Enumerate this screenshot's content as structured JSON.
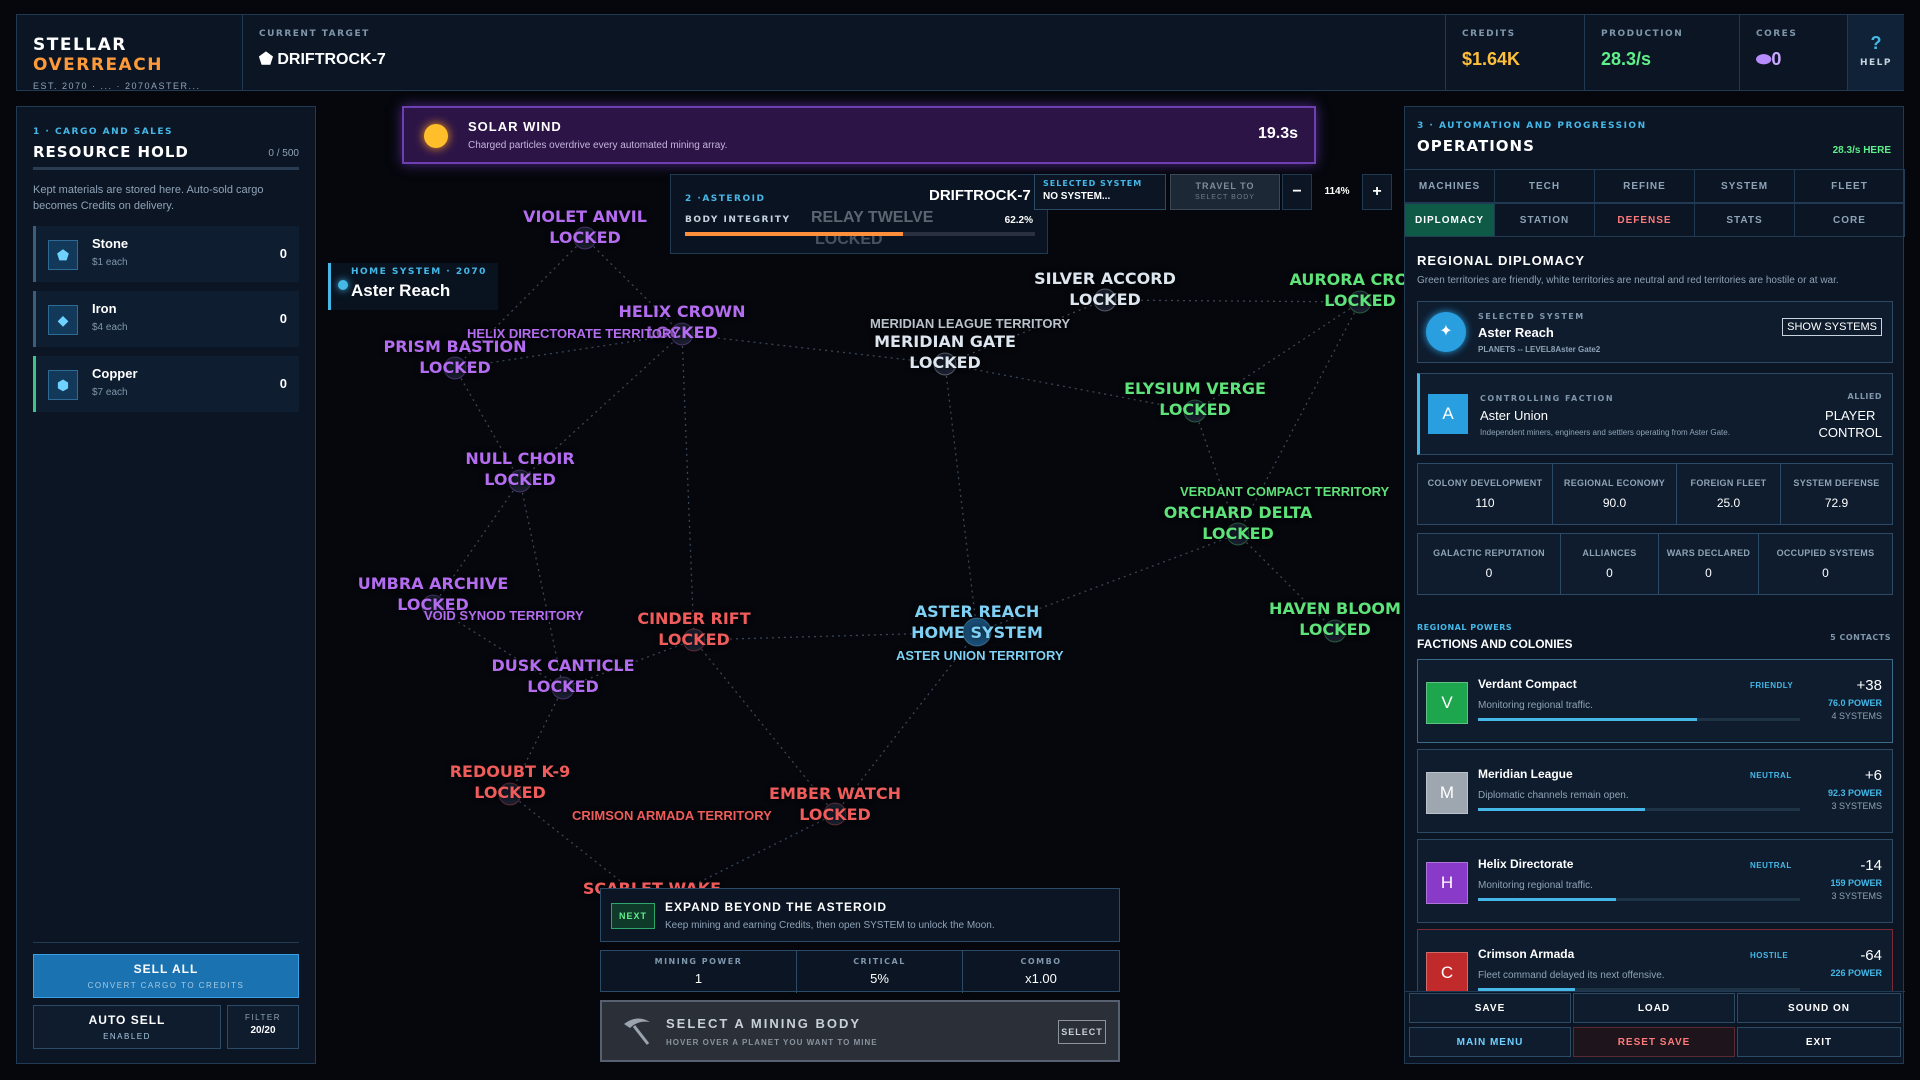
{
  "topbar": {
    "brand_1": "STELLAR ",
    "brand_2": "OVERREACH",
    "brand_sub": "EST. 2070 · ... · 2070ASTER...",
    "target_label": "CURRENT TARGET",
    "target_value": "DRIFTROCK-7",
    "credits_label": "CREDITS",
    "credits_value": "$1.64K",
    "production_label": "PRODUCTION",
    "production_value": "28.3/s",
    "cores_label": "CORES",
    "cores_value": "0",
    "help_icon": "?",
    "help_label": "HELP"
  },
  "left": {
    "section_label": "1 · CARGO AND SALES",
    "title": "RESOURCE HOLD",
    "capacity": "0 / 500",
    "desc": "Kept materials are stored here. Auto-sold cargo becomes Credits on delivery.",
    "resources": [
      {
        "name": "Stone",
        "price": "$1 each",
        "qty": "0",
        "icon": "pentagon-icon",
        "glyph": "⬟",
        "accent": "#3a5e80"
      },
      {
        "name": "Iron",
        "price": "$4 each",
        "qty": "0",
        "icon": "diamond-icon",
        "glyph": "◆",
        "accent": "#3a5e80"
      },
      {
        "name": "Copper",
        "price": "$7 each",
        "qty": "0",
        "icon": "hexagon-icon",
        "glyph": "⬢",
        "accent": "#3fc487"
      }
    ],
    "sell_all": "SELL ALL",
    "sell_all_sub": "CONVERT CARGO TO CREDITS",
    "auto_sell": "AUTO SELL",
    "auto_sell_sub": "ENABLED",
    "filter_label": "FILTER",
    "filter_value": "20/20"
  },
  "event": {
    "title": "SOLAR WIND",
    "desc": "Charged particles overdrive every automated mining array.",
    "timer": "19.3s"
  },
  "asteroid": {
    "label": "2 ·ASTEROID",
    "name": "DRIFTROCK-7",
    "integrity_label": "BODY INTEGRITY",
    "integrity_value": "62.2%",
    "integrity": 0.622,
    "ghost_1": "RELAY TWELVE",
    "ghost_2": "LOCKED"
  },
  "map_controls": {
    "selected_label": "SELECTED SYSTEM",
    "selected_value": "NO SYSTEM...",
    "travel_1": "TRAVEL TO",
    "travel_2": "SELECT BODY",
    "zoom_out": "−",
    "zoom": "114%",
    "zoom_in": "+"
  },
  "home": {
    "label": "HOME SYSTEM · 2070",
    "name": "Aster Reach"
  },
  "map": {
    "nodes": [
      {
        "id": "violet-anvil",
        "name": "VIOLET ANVIL",
        "status": "LOCKED",
        "cls": "c-purple"
      },
      {
        "id": "helix-crown",
        "name": "HELIX CROWN",
        "status": "LOCKED",
        "cls": "c-purple"
      },
      {
        "id": "prism-bastion",
        "name": "PRISM BASTION",
        "status": "LOCKED",
        "cls": "c-purple"
      },
      {
        "id": "meridian-gate",
        "name": "MERIDIAN GATE",
        "status": "LOCKED",
        "cls": "c-white"
      },
      {
        "id": "silver-accord",
        "name": "SILVER ACCORD",
        "status": "LOCKED",
        "cls": "c-white"
      },
      {
        "id": "aurora-cross",
        "name": "AURORA CROSS",
        "status": "LOCKED",
        "cls": "c-green"
      },
      {
        "id": "elysium-verge",
        "name": "ELYSIUM VERGE",
        "status": "LOCKED",
        "cls": "c-green"
      },
      {
        "id": "null-choir",
        "name": "NULL CHOIR",
        "status": "LOCKED",
        "cls": "c-purple"
      },
      {
        "id": "orchard-delta",
        "name": "ORCHARD DELTA",
        "status": "LOCKED",
        "cls": "c-green"
      },
      {
        "id": "umbra-archive",
        "name": "UMBRA ARCHIVE",
        "status": "LOCKED",
        "cls": "c-purple"
      },
      {
        "id": "cinder-rift",
        "name": "CINDER RIFT",
        "status": "LOCKED",
        "cls": "c-red"
      },
      {
        "id": "aster-reach",
        "name": "ASTER REACH",
        "status": "HOME SYSTEM",
        "cls": "c-blue"
      },
      {
        "id": "haven-bloom",
        "name": "HAVEN BLOOM",
        "status": "LOCKED",
        "cls": "c-green"
      },
      {
        "id": "dusk-canticle",
        "name": "DUSK CANTICLE",
        "status": "LOCKED",
        "cls": "c-purple"
      },
      {
        "id": "redoubt-k9",
        "name": "REDOUBT K-9",
        "status": "LOCKED",
        "cls": "c-red"
      },
      {
        "id": "ember-watch",
        "name": "EMBER WATCH",
        "status": "LOCKED",
        "cls": "c-red"
      },
      {
        "id": "scarlet-wake",
        "name": "SCARLET WAKE",
        "status": "",
        "cls": "c-red"
      }
    ],
    "territories": {
      "helix": "HELIX DIRECTORATE TERRITORY",
      "meridian": "MERIDIAN LEAGUE TERRITORY",
      "verdant": "VERDANT COMPACT TERRITORY",
      "void": "VOID SYNOD TERRITORY",
      "aster": "ASTER UNION TERRITORY",
      "crimson": "CRIMSON ARMADA TERRITORY"
    }
  },
  "objective": {
    "badge": "NEXT",
    "title": "EXPAND BEYOND THE ASTEROID",
    "desc": "Keep mining and earning Credits, then open SYSTEM to unlock the Moon."
  },
  "mining": {
    "power_label": "MINING POWER",
    "power_value": "1",
    "critical_label": "CRITICAL",
    "critical_value": "5%",
    "combo_label": "COMBO",
    "combo_value": "x1.00",
    "action_title": "SELECT A MINING BODY",
    "action_sub": "HOVER OVER A PLANET YOU WANT TO MINE",
    "select_btn": "SELECT"
  },
  "right": {
    "section_label": "3 · AUTOMATION AND PROGRESSION",
    "title": "OPERATIONS",
    "rate": "28.3/s HERE",
    "tabs_row1": [
      "MACHINES",
      "TECH",
      "REFINE",
      "SYSTEM",
      "FLEET"
    ],
    "tabs_row2": [
      "DIPLOMACY",
      "STATION",
      "DEFENSE",
      "STATS",
      "CORE"
    ],
    "diplo_title": "REGIONAL DIPLOMACY",
    "diplo_desc": "Green territories are friendly, white territories are neutral and red territories are hostile or at war.",
    "sel_label": "SELECTED SYSTEM",
    "sel_name": "Aster Reach",
    "sel_sub": "PLANETS -- LEVEL8Aster Gate2",
    "show_systems": "SHOW SYSTEMS",
    "ctrl_label": "CONTROLLING FACTION",
    "ctrl_name": "Aster Union",
    "ctrl_desc": "Independent miners, engineers and settlers operating from Aster Gate.",
    "ctrl_tag": "ALLIED",
    "ctrl_status_1": "PLAYER",
    "ctrl_status_2": "CONTROL",
    "ctrl_avatar": "A",
    "stats1": [
      {
        "k": "COLONY DEVELOPMENT",
        "v": "110"
      },
      {
        "k": "REGIONAL ECONOMY",
        "v": "90.0"
      },
      {
        "k": "FOREIGN FLEET",
        "v": "25.0"
      },
      {
        "k": "SYSTEM DEFENSE",
        "v": "72.9"
      }
    ],
    "stats2": [
      {
        "k": "GALACTIC REPUTATION",
        "v": "0"
      },
      {
        "k": "ALLIANCES",
        "v": "0"
      },
      {
        "k": "WARS DECLARED",
        "v": "0"
      },
      {
        "k": "OCCUPIED SYSTEMS",
        "v": "0"
      }
    ],
    "powers_label": "REGIONAL POWERS",
    "powers_title": "FACTIONS AND COLONIES",
    "contacts": "5 CONTACTS",
    "factions": [
      {
        "letter": "V",
        "name": "Verdant Compact",
        "desc": "Monitoring regional traffic.",
        "status": "FRIENDLY",
        "score": "+38",
        "power": "76.0 POWER",
        "systems": "4 SYSTEMS",
        "bar": 0.68,
        "color": "#1ea64e",
        "status_color": "#45b8e8"
      },
      {
        "letter": "M",
        "name": "Meridian League",
        "desc": "Diplomatic channels remain open.",
        "status": "NEUTRAL",
        "score": "+6",
        "power": "92.3 POWER",
        "systems": "3 SYSTEMS",
        "bar": 0.52,
        "color": "#9ea7b0",
        "status_color": "#45b8e8"
      },
      {
        "letter": "H",
        "name": "Helix Directorate",
        "desc": "Monitoring regional traffic.",
        "status": "NEUTRAL",
        "score": "-14",
        "power": "159 POWER",
        "systems": "3 SYSTEMS",
        "bar": 0.43,
        "color": "#8a3ac8",
        "status_color": "#45b8e8"
      },
      {
        "letter": "C",
        "name": "Crimson Armada",
        "desc": "Fleet command delayed its next offensive.",
        "status": "HOSTILE",
        "score": "-64",
        "power": "226 POWER",
        "systems": "",
        "bar": 0.3,
        "color": "#c02a2a",
        "status_color": "#45b8e8"
      }
    ],
    "buttons": {
      "save": "SAVE",
      "load": "LOAD",
      "sound": "SOUND ON",
      "menu": "MAIN MENU",
      "reset": "RESET SAVE",
      "exit": "EXIT"
    }
  }
}
